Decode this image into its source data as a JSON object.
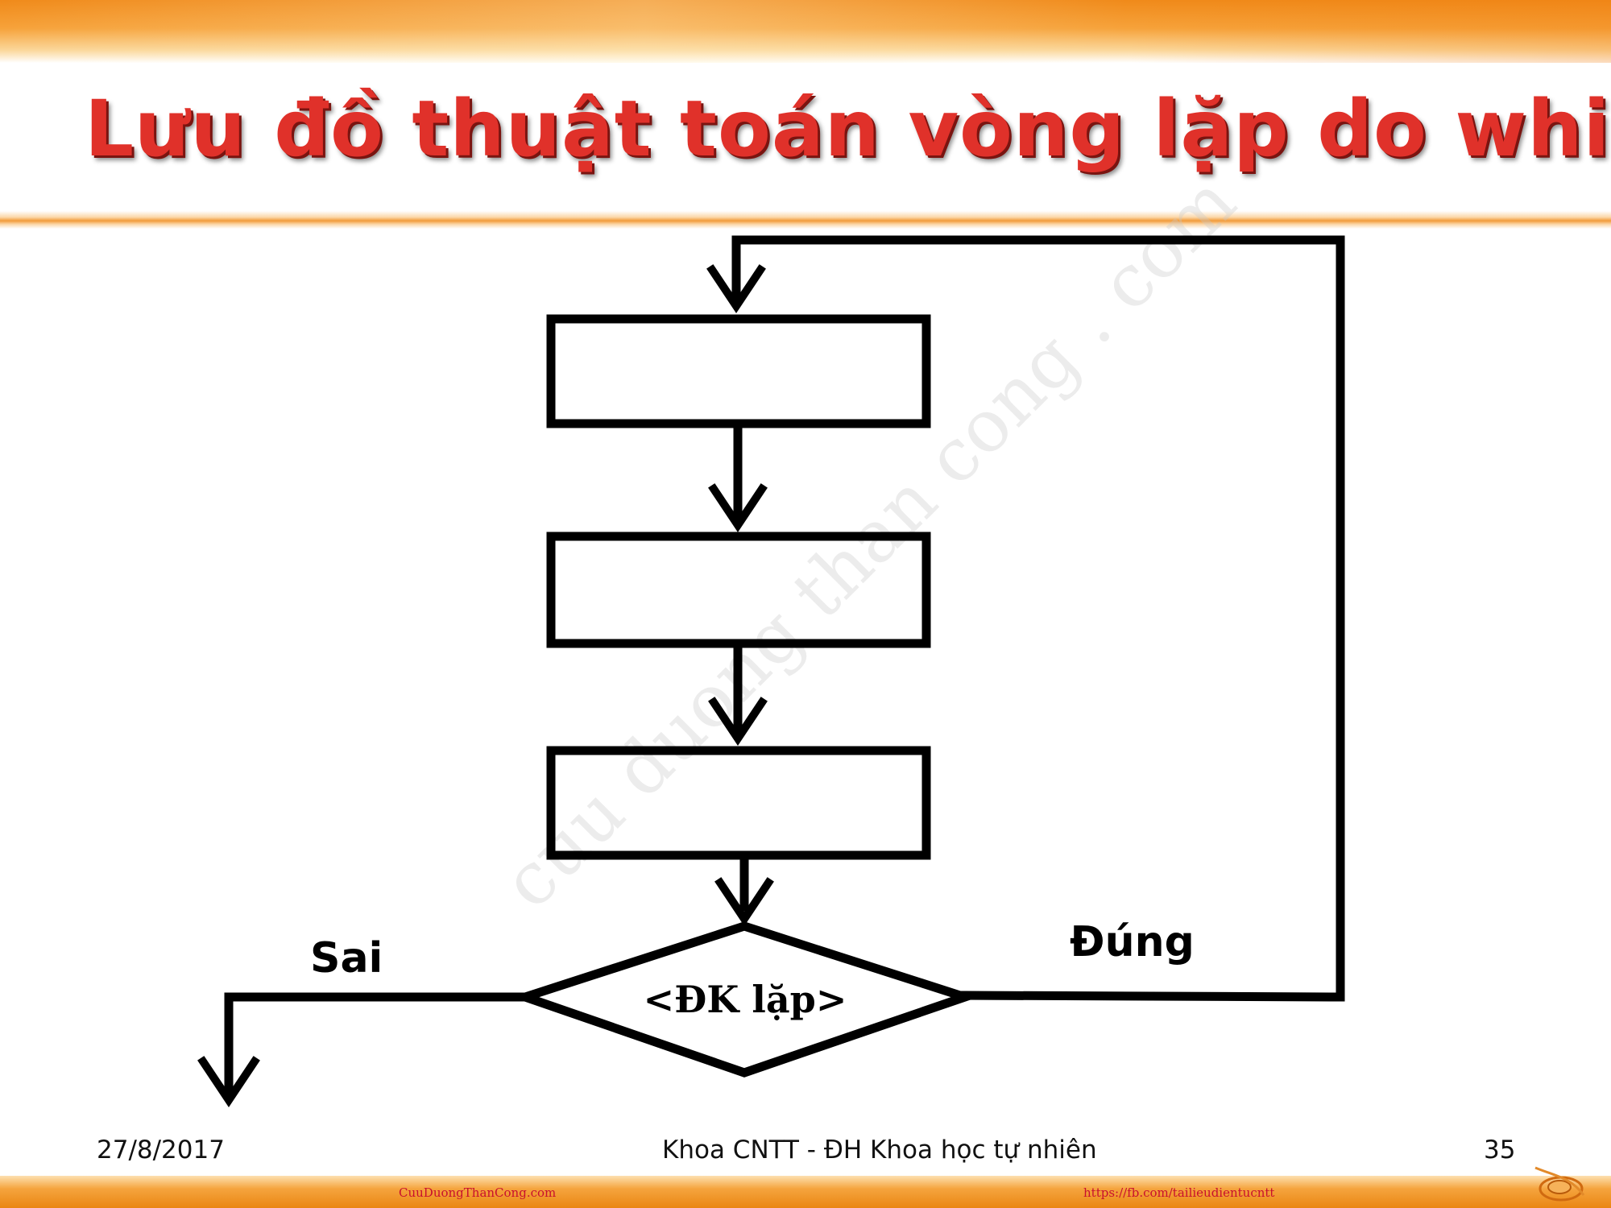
{
  "title": "Lưu đồ thuật toán vòng lặp do while",
  "watermark": "cuu duong than cong . com",
  "diagram": {
    "process_boxes": [
      "",
      "",
      ""
    ],
    "decision": "<ĐK lặp>",
    "branch_false": "Sai",
    "branch_true": "Đúng"
  },
  "footer": {
    "date": "27/8/2017",
    "center": "Khoa CNTT - ĐH Khoa học tự nhiên",
    "page": "35",
    "link_left": "CuuDuongThanCong.com",
    "link_right": "https://fb.com/tailieudientucntt"
  },
  "colors": {
    "title": "#e0312a",
    "band": "#f08a1a",
    "diagram_stroke": "#000000"
  }
}
